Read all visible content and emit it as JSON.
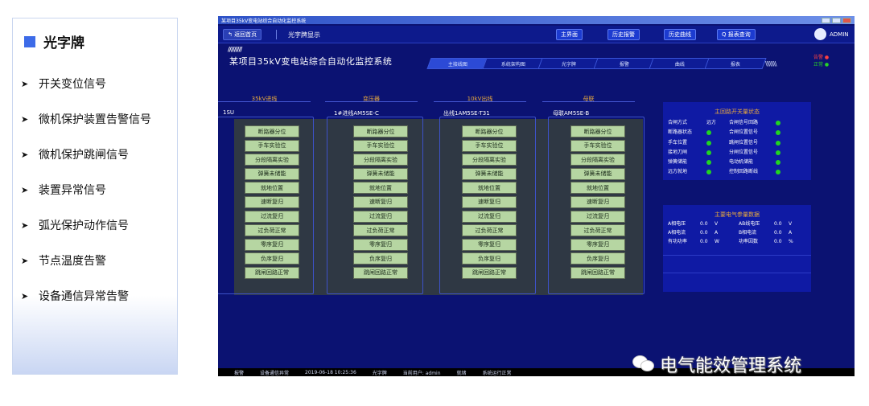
{
  "left_panel": {
    "title": "光字牌",
    "items": [
      {
        "label": "开关变位信号"
      },
      {
        "label": "微机保护装置告警信号"
      },
      {
        "label": "微机保护跳闸信号"
      },
      {
        "label": "装置异常信号"
      },
      {
        "label": "弧光保护动作信号"
      },
      {
        "label": "节点温度告警"
      },
      {
        "label": "设备通信异常告警"
      }
    ]
  },
  "window": {
    "toolbar": {
      "back": "↰ 返回首页",
      "section": "光字牌显示",
      "buttons": [
        "主界面",
        "历史报警",
        "历史曲线",
        "Q 报表查询"
      ],
      "user": "ADMIN"
    },
    "system_title": "某项目35kV变电站综合自动化监控系统",
    "tabs": [
      "主接线图",
      "系统架构图",
      "光字牌",
      "报警",
      "曲线",
      "报表"
    ],
    "status_legend": [
      "告警 ●",
      "正常 ●"
    ],
    "columns": [
      {
        "header": "35kV进线",
        "device": "1SU"
      },
      {
        "header": "变压器",
        "device": "1#进线AM5SE-C"
      },
      {
        "header": "10kV出线",
        "device": "出线1AM5SE-T31"
      },
      {
        "header": "母联",
        "device": "母联AM5SE-B"
      }
    ],
    "signal_labels": [
      "断路器分位",
      "手车实验位",
      "分段隔离实验",
      "弹簧未储能",
      "就地位置",
      "速断复归",
      "过流复归",
      "过负荷正常",
      "零序复归",
      "负序复归",
      "跳闸回路正常"
    ],
    "panel1": {
      "title": "主回路开关量状态",
      "rows": [
        {
          "a": "合闸方式",
          "b": "远方",
          "c": "合闸信号回路",
          "led": true
        },
        {
          "a": "断路器状态",
          "b": "",
          "c": "合闸位置信号",
          "led": true
        },
        {
          "a": "手车位置",
          "b": "",
          "c": "跳闸位置信号",
          "led": true
        },
        {
          "a": "接地刀闸",
          "b": "",
          "c": "分闸位置信号",
          "led": true
        },
        {
          "a": "弹簧储能",
          "b": "",
          "c": "电动机储能",
          "led": true
        },
        {
          "a": "远方就地",
          "b": "",
          "c": "控制回路断线",
          "led": true
        }
      ]
    },
    "panel2": {
      "title": "主要电气参量数据",
      "rows": [
        {
          "n1": "A相电压",
          "v1": "0.0",
          "u1": "V",
          "n2": "AB线电压",
          "v2": "0.0",
          "u2": "V"
        },
        {
          "n1": "A相电流",
          "v1": "0.0",
          "u1": "A",
          "n2": "B相电流",
          "v2": "0.0",
          "u2": "A"
        },
        {
          "n1": "有功功率",
          "v1": "0.0",
          "u1": "W",
          "n2": "功率因数",
          "v2": "0.0",
          "u2": "%"
        }
      ]
    },
    "statusbar": [
      "报警",
      "设备通信异常",
      "2019-06-18 10:25:36",
      "光字牌",
      "当前用户: admin",
      "就绪",
      "系统运行正常"
    ],
    "watermark": "电气能效管理系统"
  }
}
